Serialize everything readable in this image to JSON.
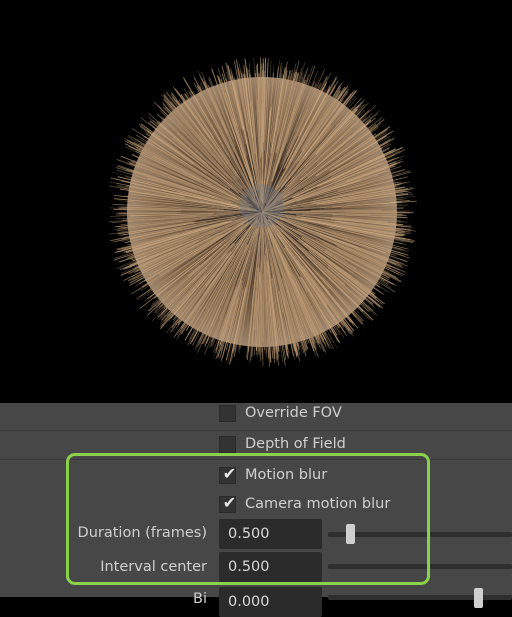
{
  "viewport": {
    "content": "fur-ball-render"
  },
  "panel": {
    "override_fov": {
      "label": "Override FOV",
      "checked": false
    },
    "depth_of_field": {
      "label": "Depth of Field",
      "checked": false
    },
    "motion_blur": {
      "label": "Motion blur",
      "checked": true,
      "check_glyph": "✔"
    },
    "camera_motion_blur": {
      "label": "Camera motion blur",
      "checked": true,
      "check_glyph": "✔"
    },
    "duration": {
      "label": "Duration (frames)",
      "value": "0.500",
      "slider_fraction": 0.1
    },
    "interval_center": {
      "label": "Interval center",
      "value": "0.500",
      "slider_fraction": 0.0
    },
    "partial_row": {
      "label": "Bi",
      "value": "0.000"
    }
  },
  "colors": {
    "highlight": "#8bd14a",
    "panel_bg": "#474747",
    "field_bg": "#2b2b2b"
  }
}
